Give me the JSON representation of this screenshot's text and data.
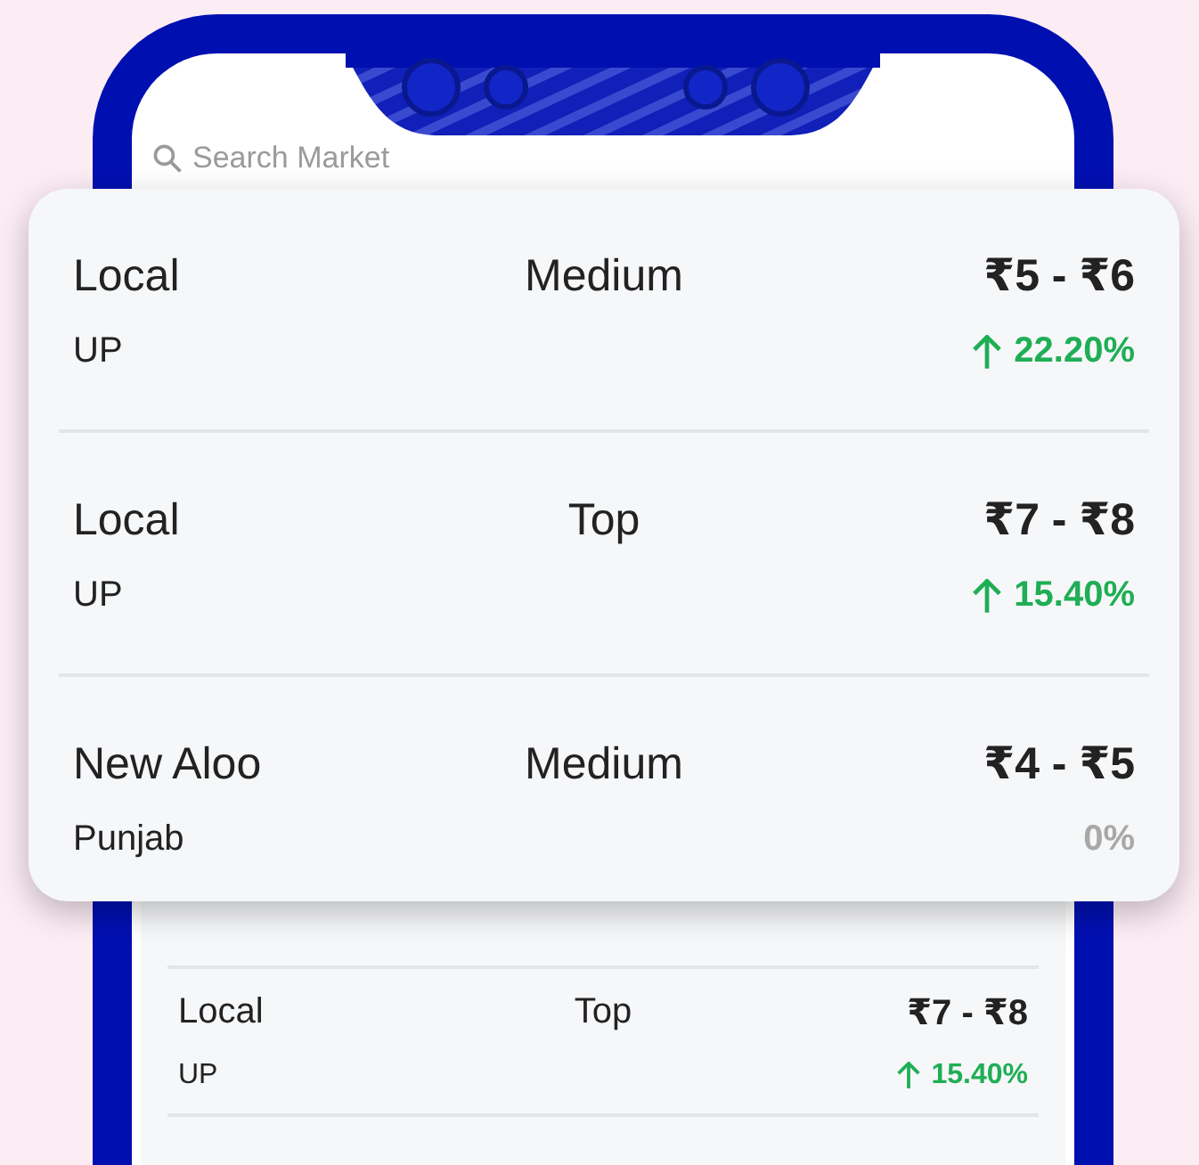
{
  "search": {
    "placeholder": "Search Market"
  },
  "popup_rows": [
    {
      "name": "Local",
      "grade": "Medium",
      "price": "₹5 - ₹6",
      "region": "UP",
      "change": "22.20%",
      "rising": true
    },
    {
      "name": "Local",
      "grade": "Top",
      "price": "₹7 - ₹8",
      "region": "UP",
      "change": "15.40%",
      "rising": true
    },
    {
      "name": "New Aloo",
      "grade": "Medium",
      "price": "₹4 - ₹5",
      "region": "Punjab",
      "change": "0%",
      "rising": false
    }
  ],
  "list_rows": [
    {
      "name": "Local",
      "grade": "Top",
      "price": "₹7 - ₹8",
      "region": "UP",
      "change": "15.40%",
      "rising": true
    }
  ]
}
